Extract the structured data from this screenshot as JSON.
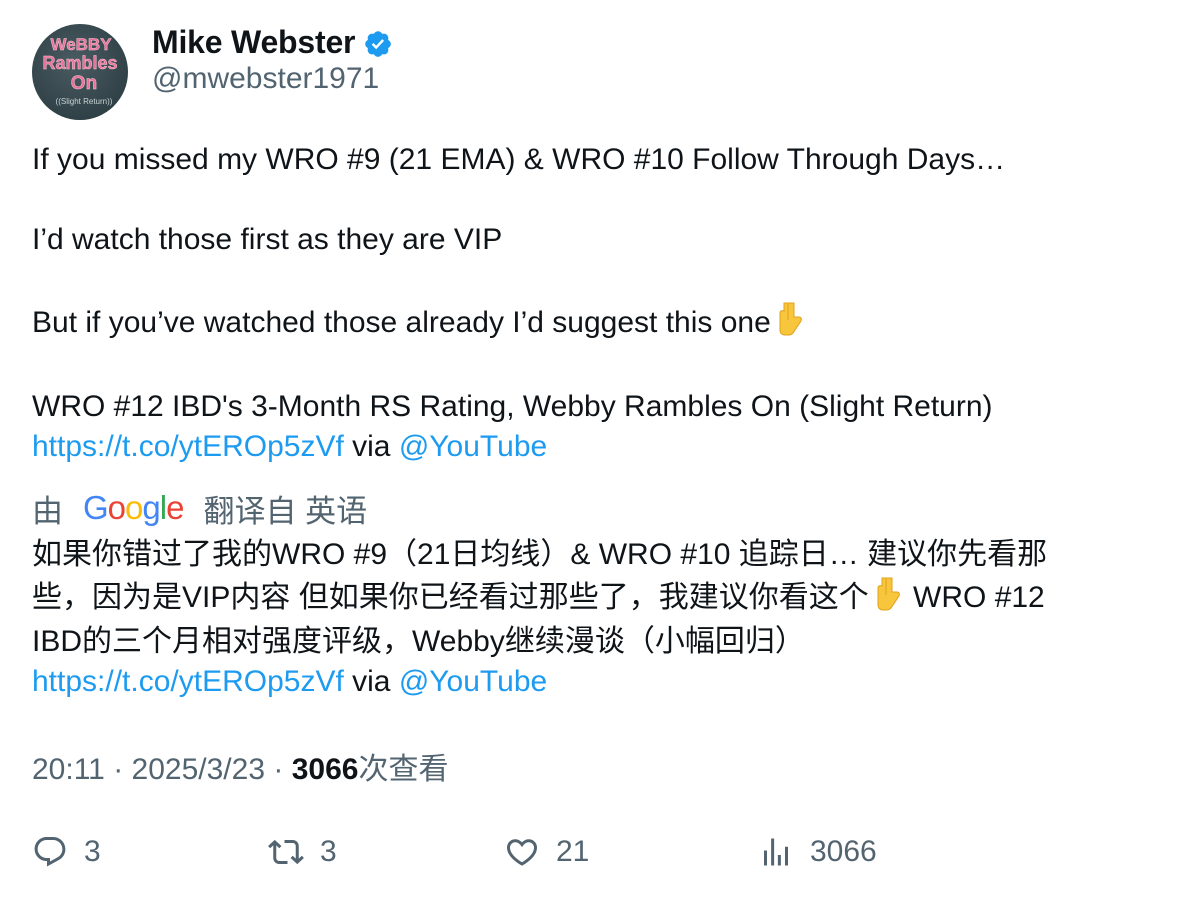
{
  "author": {
    "display_name": "Mike Webster",
    "handle": "@mwebster1971",
    "avatar_text": [
      "WeBBY",
      "Rambles",
      "On",
      "((Slight Return))"
    ]
  },
  "tweet": {
    "line1": "If you missed my WRO #9 (21 EMA) & WRO #10 Follow Through Days…",
    "line2": "I’d watch those first as they are VIP",
    "line3": "But if you’ve watched those already I’d suggest this one",
    "line3_emoji": "point-down-emoji",
    "line4": "WRO #12 IBD's 3-Month RS Rating, Webby Rambles On (Slight Return)",
    "link": "https://t.co/ytEROp5zVf",
    "via": "via",
    "mention": "@YouTube"
  },
  "translation": {
    "prefix": "由",
    "google": "Google",
    "suffix": "翻译自 英语",
    "line1": "如果你错过了我的WRO #9（21日均线）& WRO #10 追踪日… 建议你先看那",
    "line2a": "些，因为是VIP内容 但如果你已经看过那些了，我建议你看这个",
    "line2b": " WRO #12",
    "line3": "IBD的三个月相对强度评级，Webby继续漫谈（小幅回归）",
    "link": "https://t.co/ytEROp5zVf",
    "via": "via",
    "mention": "@YouTube"
  },
  "meta": {
    "time": "20:11",
    "sep": "·",
    "date": "2025/3/23",
    "views_count": "3066",
    "views_label": "次查看"
  },
  "actions": {
    "replies": "3",
    "retweets": "3",
    "likes": "21",
    "views": "3066"
  },
  "colors": {
    "link": "#1d9bf0",
    "secondary": "#536471",
    "verified": "#1d9bf0"
  }
}
